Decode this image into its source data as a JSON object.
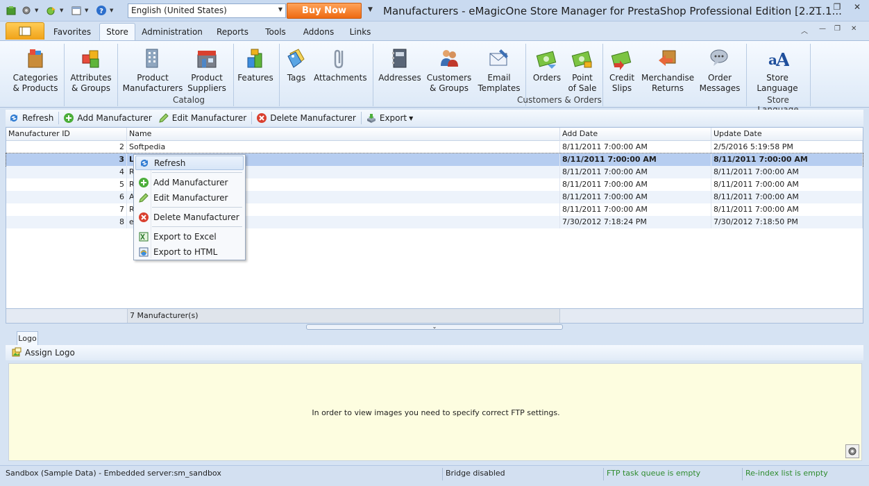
{
  "title_bar": {
    "language": "English (United States)",
    "buy_now": "Buy Now",
    "window_title": "Manufacturers - eMagicOne Store Manager for PrestaShop Professional Edition [2.21.1..."
  },
  "tabs": [
    "Favorites",
    "Store",
    "Administration",
    "Reports",
    "Tools",
    "Addons",
    "Links"
  ],
  "active_tab": "Store",
  "ribbon": {
    "catalog": {
      "label": "Catalog",
      "buttons": [
        {
          "line1": "Categories",
          "line2": "& Products",
          "icon": "box-icon"
        },
        {
          "line1": "Attributes",
          "line2": "& Groups",
          "icon": "cubes-icon"
        },
        {
          "line1": "Product",
          "line2": "Manufacturers",
          "icon": "building-icon"
        },
        {
          "line1": "Product",
          "line2": "Suppliers",
          "icon": "store-icon"
        },
        {
          "line1": "Features",
          "line2": "",
          "icon": "blocks-icon"
        },
        {
          "line1": "Tags",
          "line2": "",
          "icon": "tags-icon"
        },
        {
          "line1": "Attachments",
          "line2": "",
          "icon": "paperclip-icon"
        }
      ]
    },
    "customers": {
      "label": "Customers & Orders",
      "buttons": [
        {
          "line1": "Addresses",
          "line2": "",
          "icon": "address-book-icon"
        },
        {
          "line1": "Customers",
          "line2": "& Groups",
          "icon": "people-icon"
        },
        {
          "line1": "Email",
          "line2": "Templates",
          "icon": "envelope-icon"
        },
        {
          "line1": "Orders",
          "line2": "",
          "icon": "money-icon"
        },
        {
          "line1": "Point",
          "line2": "of Sale",
          "icon": "pos-icon"
        },
        {
          "line1": "Credit",
          "line2": "Slips",
          "icon": "credit-slip-icon"
        },
        {
          "line1": "Merchandise",
          "line2": "Returns",
          "icon": "return-icon"
        },
        {
          "line1": "Order",
          "line2": "Messages",
          "icon": "chat-icon"
        }
      ]
    },
    "store_language": {
      "label": "Store Language",
      "buttons": [
        {
          "line1": "Store",
          "line2": "Language",
          "icon": "language-icon"
        }
      ]
    }
  },
  "toolbar": {
    "refresh": "Refresh",
    "add": "Add Manufacturer",
    "edit": "Edit Manufacturer",
    "delete": "Delete Manufacturer",
    "export": "Export"
  },
  "grid": {
    "columns": [
      "Manufacturer ID",
      "Name",
      "Add Date",
      "Update Date"
    ],
    "rows": [
      {
        "id": "2",
        "name": "Softpedia",
        "add": "8/11/2011 7:00:00 AM",
        "update": "2/5/2016 5:19:58 PM"
      },
      {
        "id": "3",
        "name": "Le",
        "add": "8/11/2011 7:00:00 AM",
        "update": "8/11/2011 7:00:00 AM"
      },
      {
        "id": "4",
        "name": "R",
        "add": "8/11/2011 7:00:00 AM",
        "update": "8/11/2011 7:00:00 AM"
      },
      {
        "id": "5",
        "name": "R",
        "add": "8/11/2011 7:00:00 AM",
        "update": "8/11/2011 7:00:00 AM"
      },
      {
        "id": "6",
        "name": "A",
        "add": "8/11/2011 7:00:00 AM",
        "update": "8/11/2011 7:00:00 AM"
      },
      {
        "id": "7",
        "name": "R",
        "add": "8/11/2011 7:00:00 AM",
        "update": "8/11/2011 7:00:00 AM"
      },
      {
        "id": "8",
        "name": "e",
        "add": "7/30/2012 7:18:24 PM",
        "update": "7/30/2012 7:18:50 PM"
      }
    ],
    "selected_row_id": "3",
    "footer": "7 Manufacturer(s)"
  },
  "context_menu": {
    "refresh": "Refresh",
    "add": "Add Manufacturer",
    "edit": "Edit Manufacturer",
    "delete": "Delete Manufacturer",
    "export_excel": "Export to Excel",
    "export_html": "Export to HTML"
  },
  "logo_panel": {
    "tab": "Logo",
    "assign": "Assign Logo",
    "message": "In order to view images you need to specify correct FTP settings."
  },
  "status_bar": {
    "sandbox": "Sandbox (Sample Data) - Embedded server:sm_sandbox",
    "bridge": "Bridge disabled",
    "ftp": "FTP task queue is empty",
    "reindex": "Re-index list is empty"
  },
  "colors": {
    "accent_orange": "#ee6a12",
    "selected_row": "#b6cdf0",
    "status_green": "#2e8b2e"
  }
}
